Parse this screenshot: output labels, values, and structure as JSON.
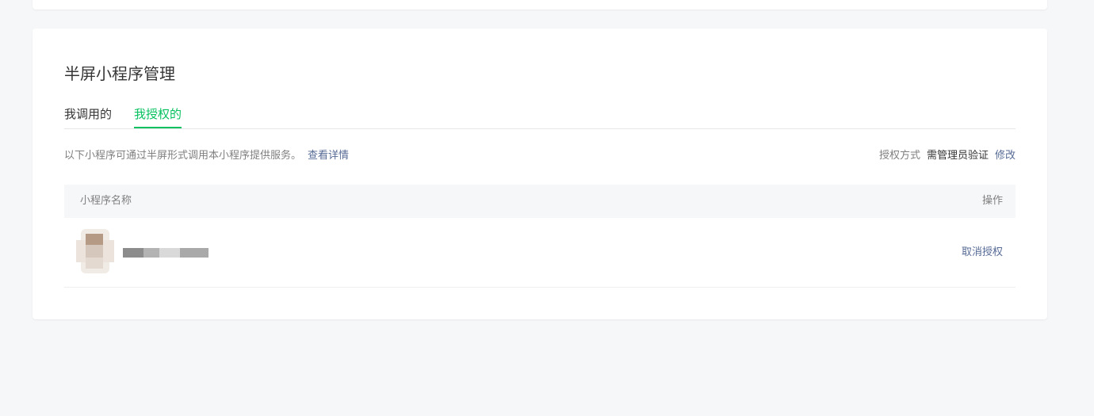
{
  "section": {
    "title": "半屏小程序管理",
    "tabs": [
      {
        "label": "我调用的",
        "active": false
      },
      {
        "label": "我授权的",
        "active": true
      }
    ],
    "description": "以下小程序可通过半屏形式调用本小程序提供服务。",
    "detail_link": "查看详情",
    "auth_mode": {
      "label": "授权方式",
      "value": "需管理员验证",
      "edit_link": "修改"
    }
  },
  "table": {
    "columns": {
      "name": "小程序名称",
      "operation": "操作"
    },
    "rows": [
      {
        "name": "",
        "action": "取消授权"
      }
    ]
  },
  "colors": {
    "accent": "#07c160",
    "link": "#576b95",
    "page_bg": "#f6f7f9"
  }
}
